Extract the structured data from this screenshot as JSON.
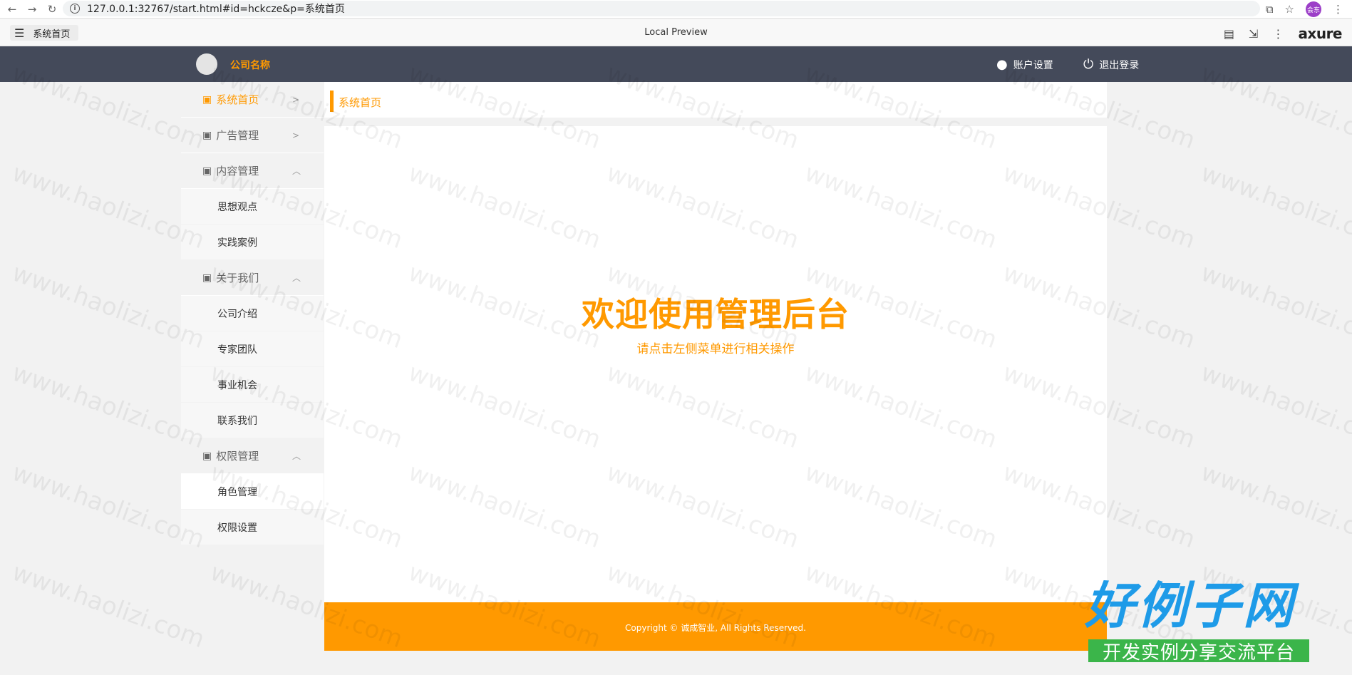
{
  "browser": {
    "url_text": "127.0.0.1:32767/start.html#id=hckcze&p=系统首页",
    "profile_initials": "会东"
  },
  "axure": {
    "page_label": "系统首页",
    "preview_label": "Local Preview",
    "logo_text": "axure"
  },
  "header": {
    "company_name": "公司名称",
    "account_settings": "账户设置",
    "logout": "退出登录"
  },
  "sidebar": {
    "groups": [
      {
        "label": "系统首页",
        "arrow": ">",
        "active": true
      },
      {
        "label": "广告管理",
        "arrow": ">"
      },
      {
        "label": "内容管理",
        "arrow": "^",
        "items": [
          "思想观点",
          "实践案例"
        ]
      },
      {
        "label": "关于我们",
        "arrow": "^",
        "items": [
          "公司介绍",
          "专家团队",
          "事业机会",
          "联系我们"
        ]
      },
      {
        "label": "权限管理",
        "arrow": "^",
        "items": [
          "角色管理",
          "权限设置"
        ]
      }
    ]
  },
  "main": {
    "breadcrumb": "系统首页",
    "welcome_title": "欢迎使用管理后台",
    "welcome_subtitle": "请点击左侧菜单进行相关操作"
  },
  "footer": {
    "copyright": "Copyright © 诚成智业, All Rights Reserved."
  },
  "brand_watermark": {
    "main": "好例子网",
    "sub": "开发实例分享交流平台"
  },
  "watermark_text": "www.haolizi.com",
  "colors": {
    "accent": "#ff9900",
    "header_bg": "#444a5a",
    "page_bg": "#f2f2f2"
  }
}
